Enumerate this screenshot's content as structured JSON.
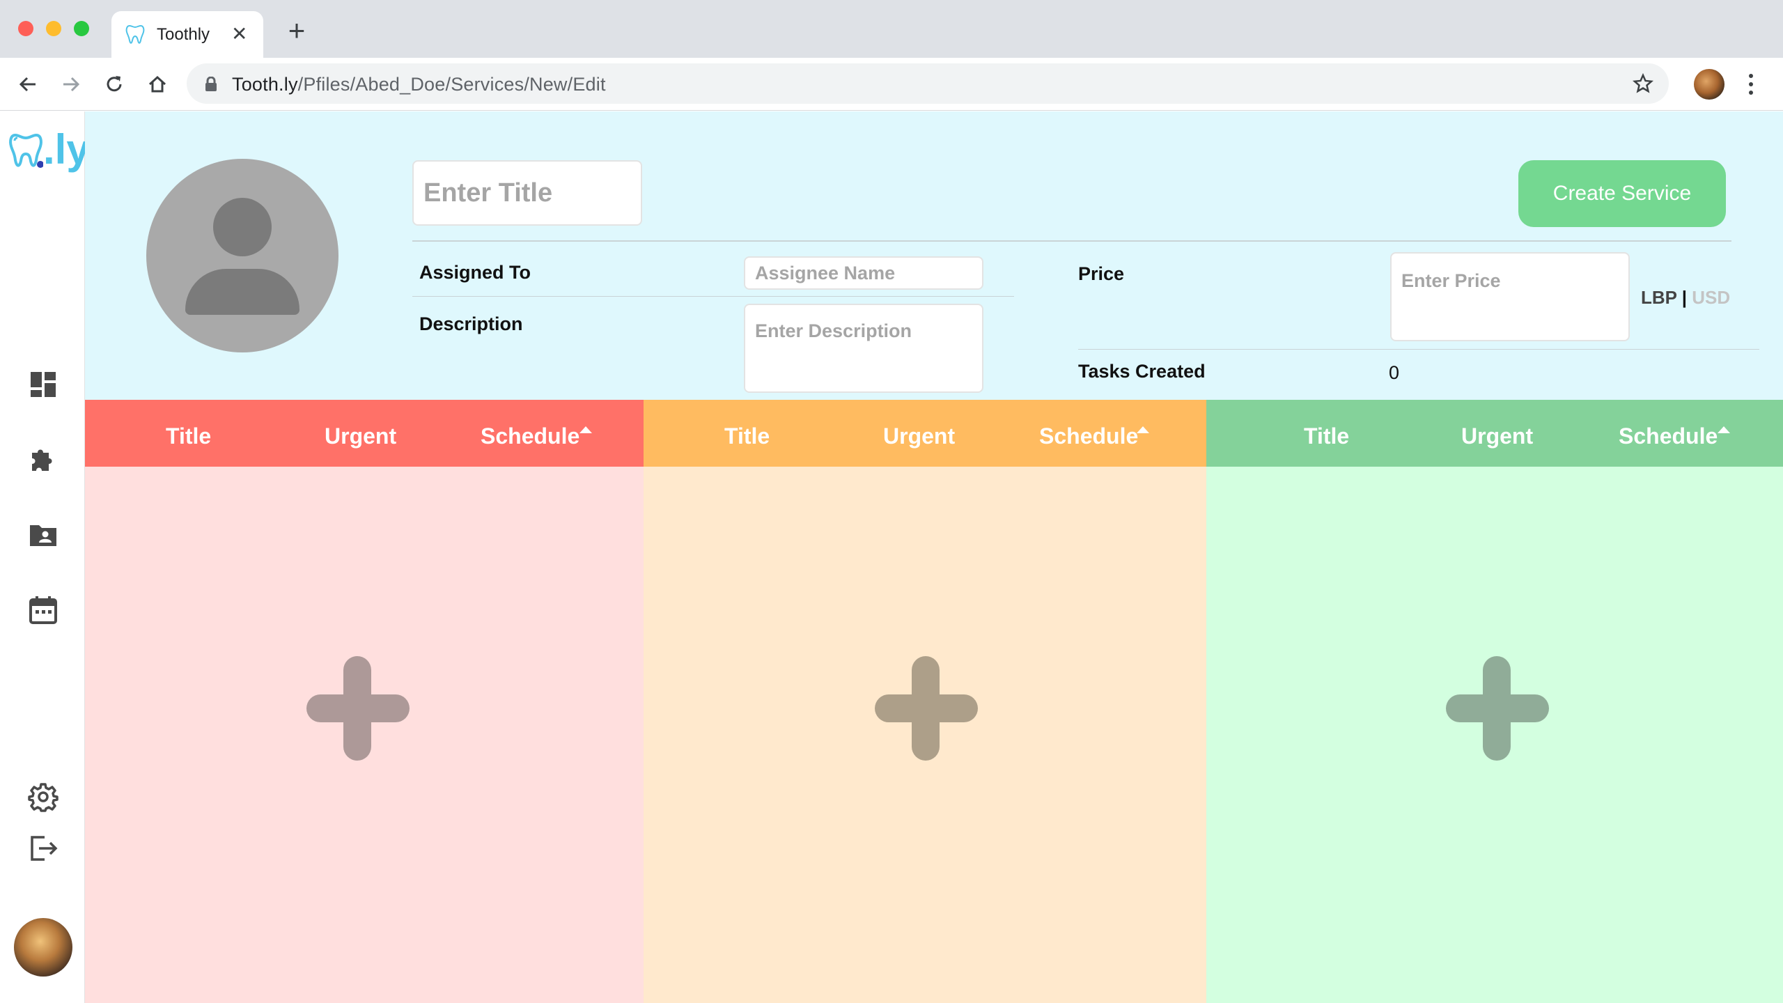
{
  "browser": {
    "tab_title": "Toothly",
    "tab_close": "✕",
    "new_tab": "+",
    "url_host": "Tooth.ly",
    "url_path": "/Pfiles/Abed_Doe/Services/New/Edit"
  },
  "sidebar": {
    "logo_text": ".ly",
    "items": [
      {
        "icon": "dashboard-icon"
      },
      {
        "icon": "puzzle-icon"
      },
      {
        "icon": "patient-folder-icon"
      },
      {
        "icon": "calendar-icon"
      },
      {
        "icon": "gear-icon"
      },
      {
        "icon": "logout-icon"
      }
    ]
  },
  "form": {
    "title_placeholder": "Enter Title",
    "create_button": "Create Service",
    "assigned_to_label": "Assigned To",
    "assignee_placeholder": "Assignee Name",
    "description_label": "Description",
    "description_placeholder": "Enter Description",
    "price_label": "Price",
    "price_placeholder": "Enter Price",
    "currency_lbp": "LBP",
    "currency_sep": "|",
    "currency_usd": "USD",
    "tasks_created_label": "Tasks Created",
    "tasks_created_value": "0"
  },
  "columns": [
    {
      "title": "Title",
      "urgent": "Urgent",
      "schedule": "Schedule",
      "header_color": "#ff7168",
      "body_color": "#ffdfde",
      "plus_color": "#ad9998"
    },
    {
      "title": "Title",
      "urgent": "Urgent",
      "schedule": "Schedule",
      "header_color": "#ffbb60",
      "body_color": "#ffe9cd",
      "plus_color": "#ad9f89"
    },
    {
      "title": "Title",
      "urgent": "Urgent",
      "schedule": "Schedule",
      "header_color": "#84d29a",
      "body_color": "#d3ffe0",
      "plus_color": "#90ac98"
    }
  ],
  "colors": {
    "header_bg": "#dff8fd",
    "create_button": "#74d891"
  }
}
